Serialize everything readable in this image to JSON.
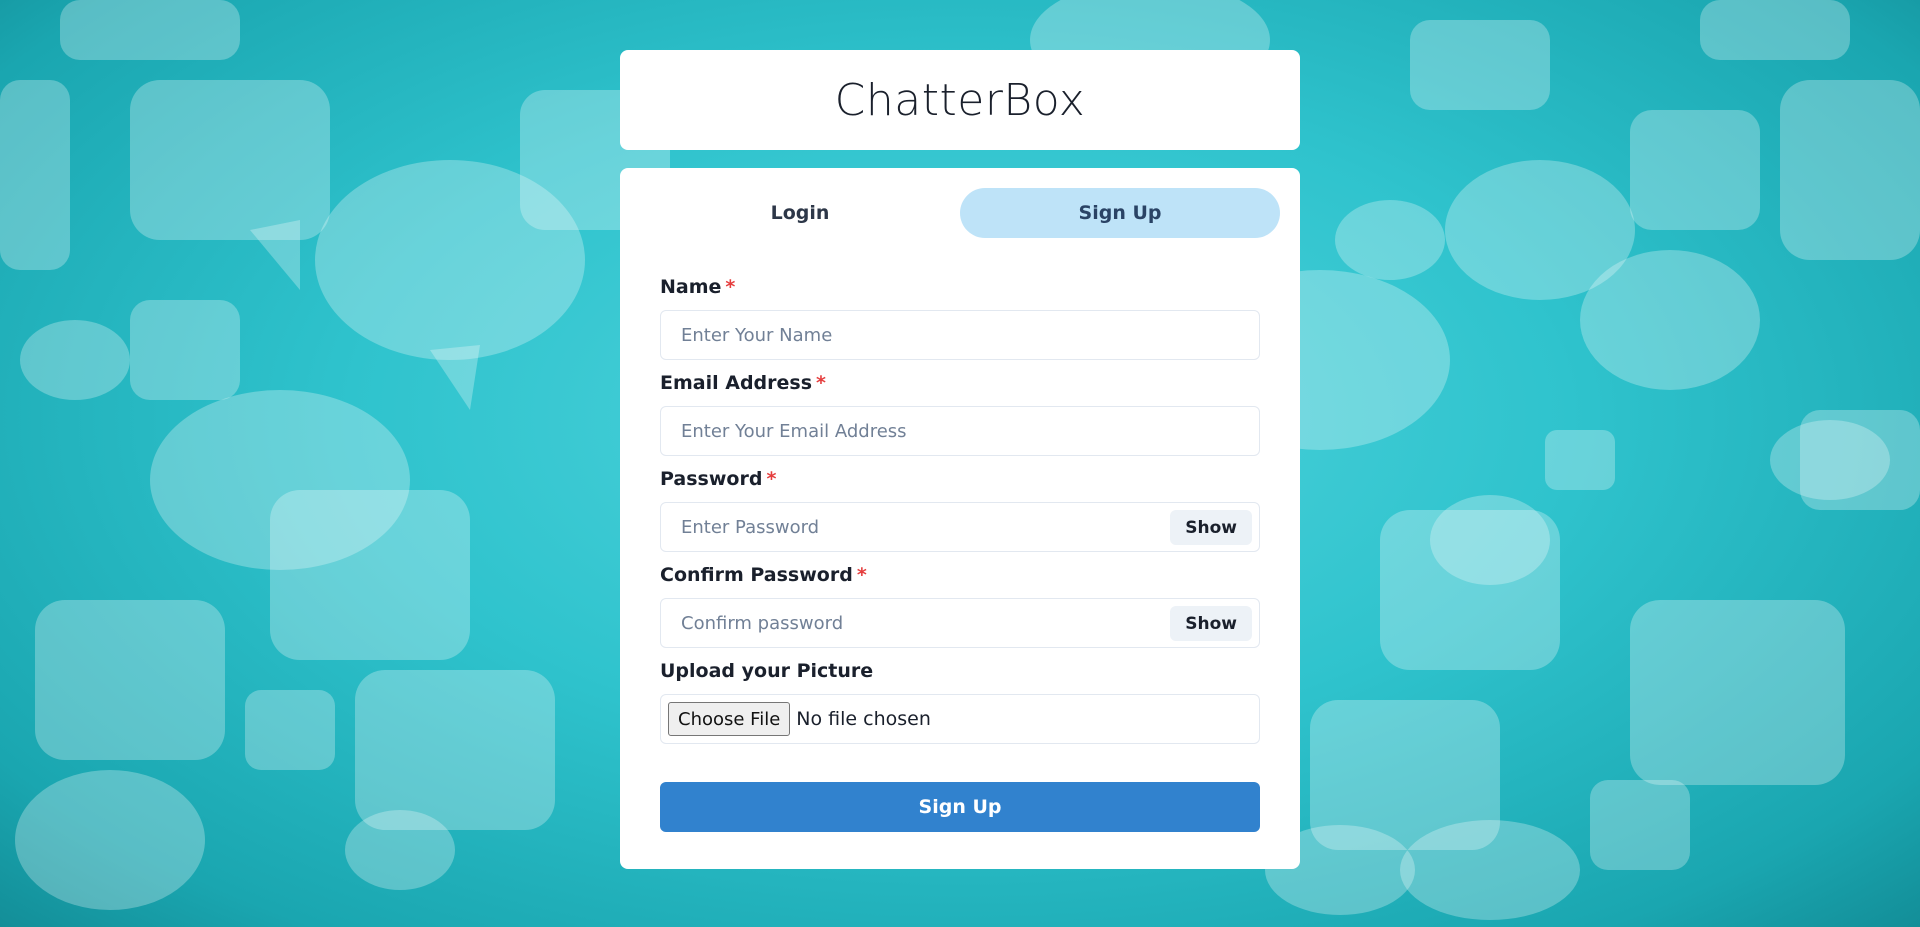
{
  "app": {
    "title": "ChatterBox"
  },
  "tabs": [
    {
      "label": "Login",
      "active": false
    },
    {
      "label": "Sign Up",
      "active": true
    }
  ],
  "form": {
    "name": {
      "label": "Name",
      "required_mark": "*",
      "placeholder": "Enter Your Name",
      "value": ""
    },
    "email": {
      "label": "Email Address",
      "required_mark": "*",
      "placeholder": "Enter Your Email Address",
      "value": ""
    },
    "password": {
      "label": "Password",
      "required_mark": "*",
      "placeholder": "Enter Password",
      "value": "",
      "toggle_label": "Show"
    },
    "confirm_password": {
      "label": "Confirm Password",
      "required_mark": "*",
      "placeholder": "Confirm password",
      "value": "",
      "toggle_label": "Show"
    },
    "picture": {
      "label": "Upload your Picture",
      "choose_label": "Choose File",
      "status": "No file chosen"
    },
    "submit_label": "Sign Up"
  },
  "colors": {
    "background_primary": "#2fc3cd",
    "card_background": "#ffffff",
    "active_tab_background": "#bee3f8",
    "submit_button": "#3182ce",
    "required_mark": "#e53e3e"
  }
}
